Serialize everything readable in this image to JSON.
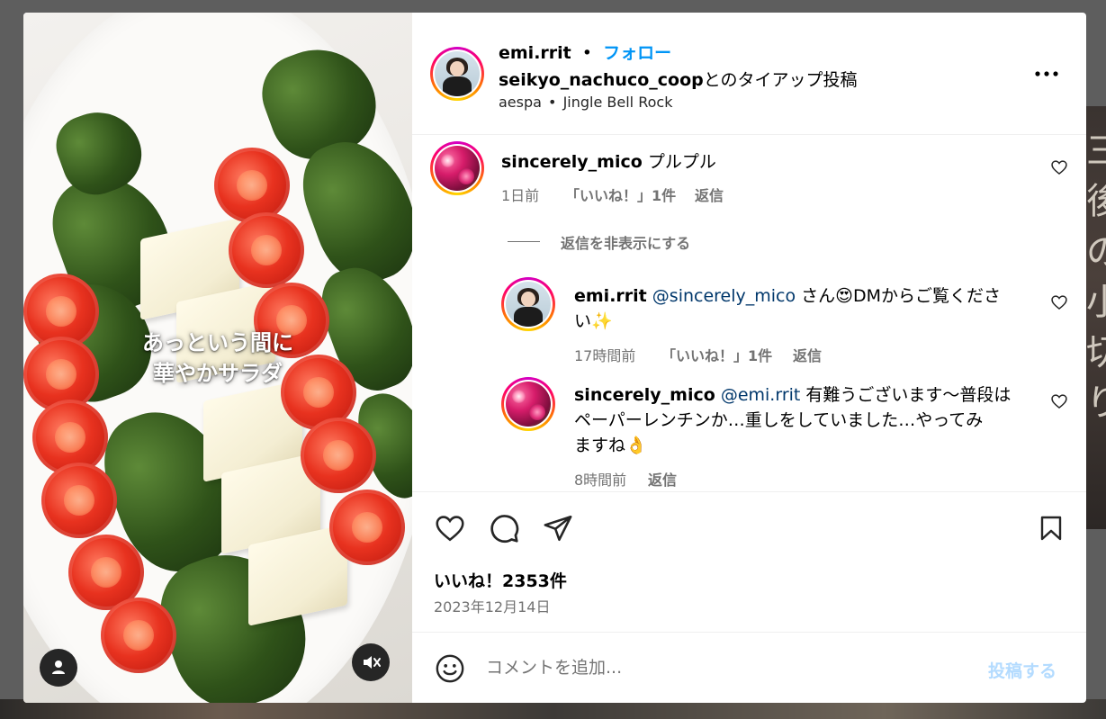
{
  "header": {
    "username": "emi.rrit",
    "separator": "•",
    "follow_label": "フォロー",
    "partner_username": "seikyo_nachuco_coop",
    "partnership_suffix": "とのタイアップ投稿",
    "audio_artist": "aespa",
    "audio_separator": "•",
    "audio_title": "Jingle Bell Rock",
    "more_label": "•••"
  },
  "media": {
    "overlay_line1": "あっという間に",
    "overlay_line2": "華やかサラダ"
  },
  "comments": [
    {
      "username": "sincerely_mico",
      "text": "プルプル",
      "time": "1日前",
      "likes": "「いいね！」1件",
      "reply_label": "返信"
    }
  ],
  "hide_replies_label": "返信を非表示にする",
  "replies": [
    {
      "username": "emi.rrit",
      "mention": "@sincerely_mico",
      "text_line1": "さん😍DMからご覧くださ",
      "text_line2": "い✨",
      "time": "17時間前",
      "likes": "「いいね！」1件",
      "reply_label": "返信"
    },
    {
      "username": "sincerely_mico",
      "mention": "@emi.rrit",
      "text_line1": "有難うございます～普段は",
      "text_line2": "ペーパーレンチンか…重しをしていました…やってみ",
      "text_line3": "ますね👌",
      "time": "8時間前",
      "reply_label": "返信"
    }
  ],
  "stats": {
    "likes": "いいね！2353件",
    "date": "2023年12月14日"
  },
  "comment_input": {
    "placeholder": "コメントを追加...",
    "post_label": "投稿する"
  },
  "background": {
    "right_text": "三 後 の 小 切 り"
  },
  "colors": {
    "follow": "#0095f6",
    "mention": "#00376b",
    "post_disabled": "#b3dbff",
    "muted": "#737373"
  }
}
